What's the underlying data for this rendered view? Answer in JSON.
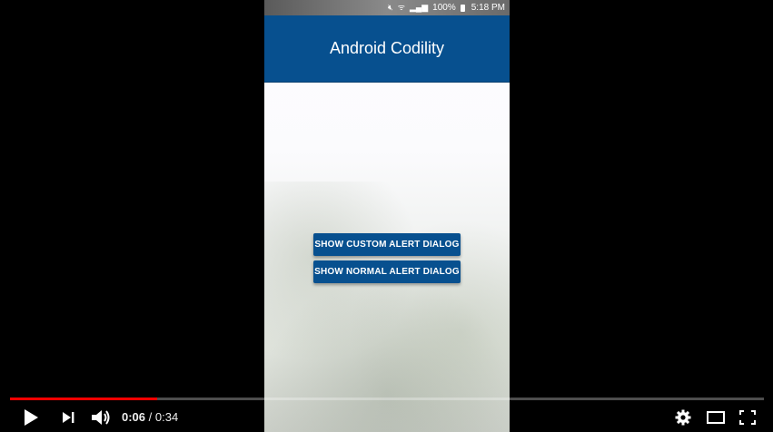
{
  "video": {
    "progress_fraction": 0.195,
    "current_time": "0:06",
    "separator": " / ",
    "duration": "0:34"
  },
  "phone": {
    "status_bar": {
      "battery": "100%",
      "time": "5:18 PM"
    },
    "app_bar": {
      "title": "Android Codility"
    },
    "buttons": {
      "custom": "SHOW CUSTOM ALERT DIALOG",
      "normal": "SHOW NORMAL ALERT DIALOG"
    }
  },
  "icons": {
    "play": "play-icon",
    "next": "next-icon",
    "volume": "volume-icon",
    "settings": "gear-icon",
    "theater": "theater-mode-icon",
    "fullscreen": "fullscreen-icon"
  },
  "colors": {
    "app_bar": "#07508f",
    "progress": "#ff0000"
  }
}
